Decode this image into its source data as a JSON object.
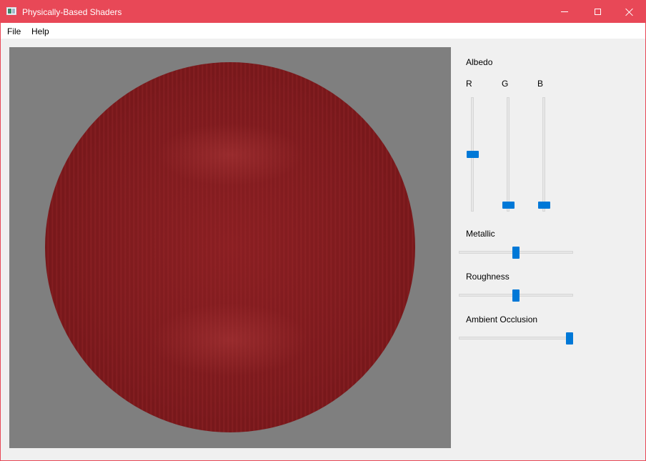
{
  "window": {
    "title": "Physically-Based Shaders",
    "accent_color": "#e84857"
  },
  "menu": {
    "file": "File",
    "help": "Help"
  },
  "viewport": {
    "background_color": "#7f7f7f",
    "sphere_color": "#7c1a1d"
  },
  "controls": {
    "albedo": {
      "label": "Albedo",
      "r": {
        "label": "R",
        "value": 0.5
      },
      "g": {
        "label": "G",
        "value": 0.03
      },
      "b": {
        "label": "B",
        "value": 0.03
      }
    },
    "metallic": {
      "label": "Metallic",
      "value": 0.5
    },
    "roughness": {
      "label": "Roughness",
      "value": 0.5
    },
    "ambient_occlusion": {
      "label": "Ambient Occlusion",
      "value": 1.0
    },
    "slider_color": "#0078d7"
  }
}
